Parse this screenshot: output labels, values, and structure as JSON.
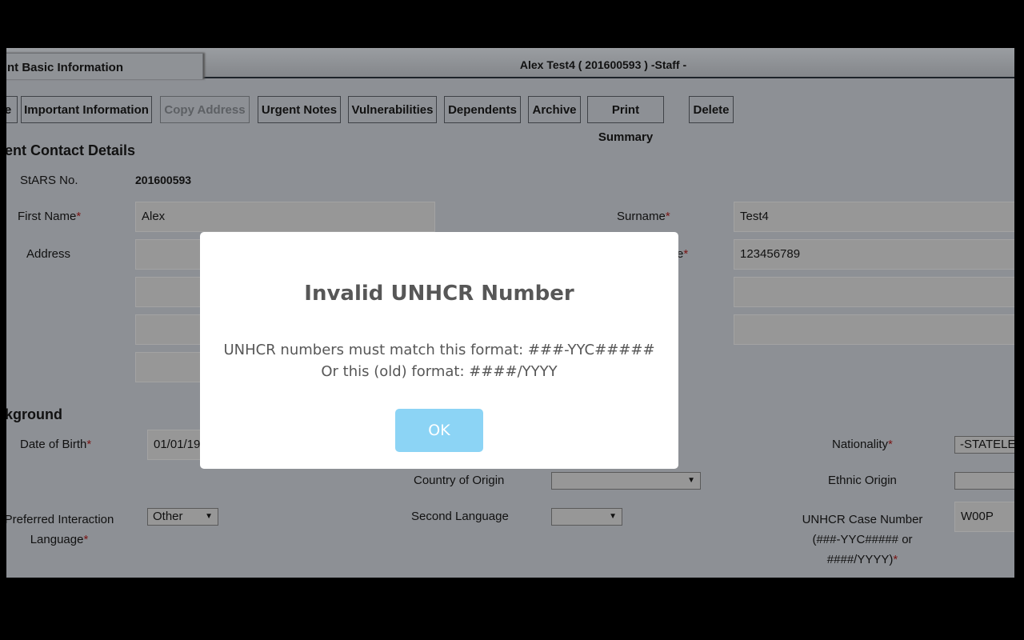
{
  "tabs": {
    "active_label": "nt Basic Information"
  },
  "record_title": "Alex Test4 ( 201600593 ) -Staff -",
  "toolbar": {
    "buttons": [
      {
        "label": "e",
        "enabled": true
      },
      {
        "label": "Important Information",
        "enabled": true
      },
      {
        "label": "Copy Address",
        "enabled": false
      },
      {
        "label": "Urgent Notes",
        "enabled": true
      },
      {
        "label": "Vulnerabilities",
        "enabled": true
      },
      {
        "label": "Dependents",
        "enabled": true
      },
      {
        "label": "Archive",
        "enabled": true
      },
      {
        "label": "Print Summary",
        "enabled": true
      },
      {
        "label": "Delete",
        "enabled": true
      }
    ]
  },
  "contact": {
    "heading": "ent Contact Details",
    "stars_label": "StARS No.",
    "stars_value": "201600593",
    "first_name_label": "First Name",
    "first_name_value": "Alex",
    "surname_label": "Surname",
    "surname_value": "Test4",
    "address_label": "Address",
    "phone_label_fragment": "e",
    "phone_value": "123456789",
    "required_mark": "*"
  },
  "background": {
    "heading": "kground",
    "dob_label": "Date of Birth",
    "dob_value": "01/01/19",
    "nationality_label": "Nationality",
    "nationality_value": "-STATELE",
    "country_label": "Country of Origin",
    "country_value": "",
    "ethnic_label": "Ethnic Origin",
    "ethnic_value": "",
    "pref_lang_label_1": "Preferred Interaction",
    "pref_lang_label_2": "Language",
    "pref_lang_value": "Other",
    "second_lang_label": "Second Language",
    "second_lang_value": "",
    "unhcr_label_1": "UNHCR Case Number",
    "unhcr_label_2": "(###-YYC##### or",
    "unhcr_label_3": "####/YYYY)",
    "unhcr_value": "W00P"
  },
  "modal": {
    "title": "Invalid UNHCR Number",
    "line1": "UNHCR numbers must match this format: ###-YYC#####",
    "line2": "Or this (old) format: ####/YYYY",
    "ok_label": "OK",
    "ok_color": "#8cd4f5"
  }
}
